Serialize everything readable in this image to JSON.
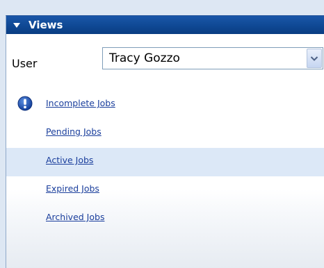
{
  "views": {
    "title": "Views",
    "user_label": "User",
    "user_selected": "Tracy Gozzo",
    "items": [
      {
        "label": "Incomplete Jobs",
        "has_alert": true,
        "active": false
      },
      {
        "label": "Pending Jobs",
        "has_alert": false,
        "active": false
      },
      {
        "label": "Active Jobs",
        "has_alert": false,
        "active": true
      },
      {
        "label": "Expired Jobs",
        "has_alert": false,
        "active": false
      },
      {
        "label": "Archived Jobs",
        "has_alert": false,
        "active": false
      }
    ]
  },
  "icons": {
    "header": "triangle-down-icon",
    "dropdown": "chevron-down-icon",
    "alert": "exclamation-circle-icon"
  },
  "colors": {
    "header_bg": "#0f4894",
    "link": "#1a3e9c",
    "active_row": "#dce8f7"
  }
}
